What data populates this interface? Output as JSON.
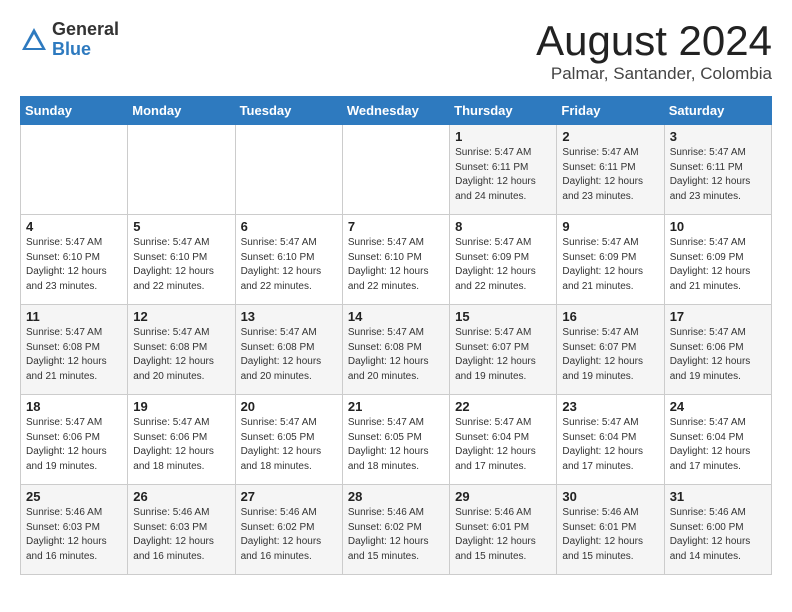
{
  "header": {
    "logo_general": "General",
    "logo_blue": "Blue",
    "month_title": "August 2024",
    "location": "Palmar, Santander, Colombia"
  },
  "calendar": {
    "days_of_week": [
      "Sunday",
      "Monday",
      "Tuesday",
      "Wednesday",
      "Thursday",
      "Friday",
      "Saturday"
    ],
    "weeks": [
      [
        {
          "day": "",
          "info": ""
        },
        {
          "day": "",
          "info": ""
        },
        {
          "day": "",
          "info": ""
        },
        {
          "day": "",
          "info": ""
        },
        {
          "day": "1",
          "info": "Sunrise: 5:47 AM\nSunset: 6:11 PM\nDaylight: 12 hours\nand 24 minutes."
        },
        {
          "day": "2",
          "info": "Sunrise: 5:47 AM\nSunset: 6:11 PM\nDaylight: 12 hours\nand 23 minutes."
        },
        {
          "day": "3",
          "info": "Sunrise: 5:47 AM\nSunset: 6:11 PM\nDaylight: 12 hours\nand 23 minutes."
        }
      ],
      [
        {
          "day": "4",
          "info": "Sunrise: 5:47 AM\nSunset: 6:10 PM\nDaylight: 12 hours\nand 23 minutes."
        },
        {
          "day": "5",
          "info": "Sunrise: 5:47 AM\nSunset: 6:10 PM\nDaylight: 12 hours\nand 22 minutes."
        },
        {
          "day": "6",
          "info": "Sunrise: 5:47 AM\nSunset: 6:10 PM\nDaylight: 12 hours\nand 22 minutes."
        },
        {
          "day": "7",
          "info": "Sunrise: 5:47 AM\nSunset: 6:10 PM\nDaylight: 12 hours\nand 22 minutes."
        },
        {
          "day": "8",
          "info": "Sunrise: 5:47 AM\nSunset: 6:09 PM\nDaylight: 12 hours\nand 22 minutes."
        },
        {
          "day": "9",
          "info": "Sunrise: 5:47 AM\nSunset: 6:09 PM\nDaylight: 12 hours\nand 21 minutes."
        },
        {
          "day": "10",
          "info": "Sunrise: 5:47 AM\nSunset: 6:09 PM\nDaylight: 12 hours\nand 21 minutes."
        }
      ],
      [
        {
          "day": "11",
          "info": "Sunrise: 5:47 AM\nSunset: 6:08 PM\nDaylight: 12 hours\nand 21 minutes."
        },
        {
          "day": "12",
          "info": "Sunrise: 5:47 AM\nSunset: 6:08 PM\nDaylight: 12 hours\nand 20 minutes."
        },
        {
          "day": "13",
          "info": "Sunrise: 5:47 AM\nSunset: 6:08 PM\nDaylight: 12 hours\nand 20 minutes."
        },
        {
          "day": "14",
          "info": "Sunrise: 5:47 AM\nSunset: 6:08 PM\nDaylight: 12 hours\nand 20 minutes."
        },
        {
          "day": "15",
          "info": "Sunrise: 5:47 AM\nSunset: 6:07 PM\nDaylight: 12 hours\nand 19 minutes."
        },
        {
          "day": "16",
          "info": "Sunrise: 5:47 AM\nSunset: 6:07 PM\nDaylight: 12 hours\nand 19 minutes."
        },
        {
          "day": "17",
          "info": "Sunrise: 5:47 AM\nSunset: 6:06 PM\nDaylight: 12 hours\nand 19 minutes."
        }
      ],
      [
        {
          "day": "18",
          "info": "Sunrise: 5:47 AM\nSunset: 6:06 PM\nDaylight: 12 hours\nand 19 minutes."
        },
        {
          "day": "19",
          "info": "Sunrise: 5:47 AM\nSunset: 6:06 PM\nDaylight: 12 hours\nand 18 minutes."
        },
        {
          "day": "20",
          "info": "Sunrise: 5:47 AM\nSunset: 6:05 PM\nDaylight: 12 hours\nand 18 minutes."
        },
        {
          "day": "21",
          "info": "Sunrise: 5:47 AM\nSunset: 6:05 PM\nDaylight: 12 hours\nand 18 minutes."
        },
        {
          "day": "22",
          "info": "Sunrise: 5:47 AM\nSunset: 6:04 PM\nDaylight: 12 hours\nand 17 minutes."
        },
        {
          "day": "23",
          "info": "Sunrise: 5:47 AM\nSunset: 6:04 PM\nDaylight: 12 hours\nand 17 minutes."
        },
        {
          "day": "24",
          "info": "Sunrise: 5:47 AM\nSunset: 6:04 PM\nDaylight: 12 hours\nand 17 minutes."
        }
      ],
      [
        {
          "day": "25",
          "info": "Sunrise: 5:46 AM\nSunset: 6:03 PM\nDaylight: 12 hours\nand 16 minutes."
        },
        {
          "day": "26",
          "info": "Sunrise: 5:46 AM\nSunset: 6:03 PM\nDaylight: 12 hours\nand 16 minutes."
        },
        {
          "day": "27",
          "info": "Sunrise: 5:46 AM\nSunset: 6:02 PM\nDaylight: 12 hours\nand 16 minutes."
        },
        {
          "day": "28",
          "info": "Sunrise: 5:46 AM\nSunset: 6:02 PM\nDaylight: 12 hours\nand 15 minutes."
        },
        {
          "day": "29",
          "info": "Sunrise: 5:46 AM\nSunset: 6:01 PM\nDaylight: 12 hours\nand 15 minutes."
        },
        {
          "day": "30",
          "info": "Sunrise: 5:46 AM\nSunset: 6:01 PM\nDaylight: 12 hours\nand 15 minutes."
        },
        {
          "day": "31",
          "info": "Sunrise: 5:46 AM\nSunset: 6:00 PM\nDaylight: 12 hours\nand 14 minutes."
        }
      ]
    ]
  }
}
